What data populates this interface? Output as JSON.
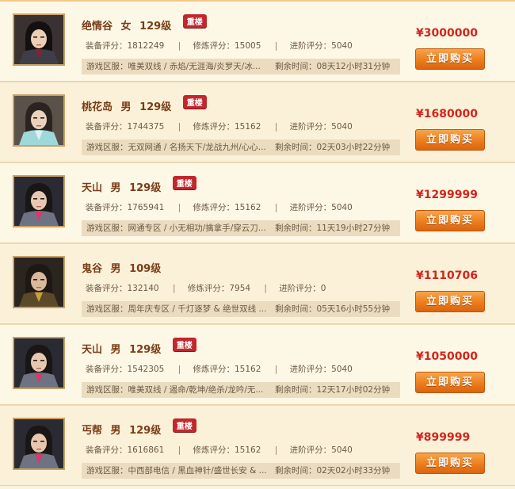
{
  "currency_symbol": "¥",
  "labels": {
    "equip_score": "装备评分：",
    "practice_score": "修炼评分：",
    "advance_score": "进阶评分：",
    "server": "游戏区服：",
    "remaining": "剩余时间：",
    "buy_button": "立即购买",
    "badge": "重楼"
  },
  "colors": {
    "accent_price": "#d3251b",
    "button": "#ec7d1c",
    "badge": "#c1272d",
    "title": "#7a3d18"
  },
  "listings": [
    {
      "sect": "绝情谷",
      "gender": "女",
      "level": "129级",
      "badge": true,
      "equip_score": "1812249",
      "practice_score": "15005",
      "advance_score": "5040",
      "server": "唯美双线 / 赤焰/无涯海/炎罗天/冰...",
      "remaining": "08天12小时31分钟",
      "price": "3000000",
      "avatar": "female-character-portrait"
    },
    {
      "sect": "桃花岛",
      "gender": "男",
      "level": "129级",
      "badge": true,
      "equip_score": "1744375",
      "practice_score": "15162",
      "advance_score": "5040",
      "server": "无双网通 / 名扬天下/龙战九州/心心...",
      "remaining": "02天03小时22分钟",
      "price": "1680000",
      "avatar": "male-character-portrait-light"
    },
    {
      "sect": "天山",
      "gender": "男",
      "level": "129级",
      "badge": true,
      "equip_score": "1765941",
      "practice_score": "15162",
      "advance_score": "5040",
      "server": "网通专区 / 小无相功/擒拿手/穿云刀...",
      "remaining": "11天19小时27分钟",
      "price": "1299999",
      "avatar": "male-character-portrait-armored"
    },
    {
      "sect": "鬼谷",
      "gender": "男",
      "level": "109级",
      "badge": false,
      "equip_score": "132140",
      "practice_score": "7954",
      "advance_score": "0",
      "server": "周年庆专区 / 千灯逐梦 & 绝世双线 ...",
      "remaining": "05天16小时55分钟",
      "price": "1110706",
      "avatar": "male-character-portrait-dark"
    },
    {
      "sect": "天山",
      "gender": "男",
      "level": "129级",
      "badge": true,
      "equip_score": "1542305",
      "practice_score": "15162",
      "advance_score": "5040",
      "server": "唯美双线 / 遏命/乾坤/绝杀/龙吟/无...",
      "remaining": "12天17小时02分钟",
      "price": "1050000",
      "avatar": "male-character-portrait-armored"
    },
    {
      "sect": "丐帮",
      "gender": "男",
      "level": "129级",
      "badge": true,
      "equip_score": "1616861",
      "practice_score": "15162",
      "advance_score": "5040",
      "server": "中西部电信 / 黑血神针/盛世长安 & ...",
      "remaining": "02天02小时33分钟",
      "price": "899999",
      "avatar": "male-character-portrait-armored"
    }
  ]
}
